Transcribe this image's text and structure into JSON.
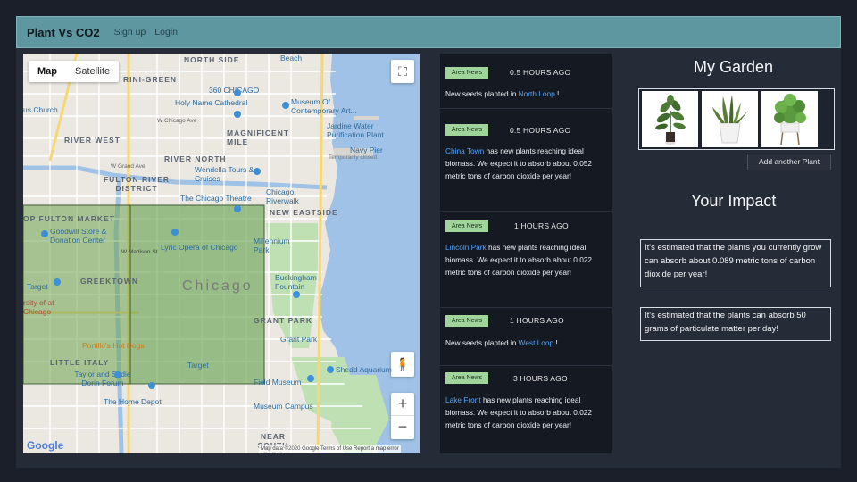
{
  "navbar": {
    "brand": "Plant Vs CO2",
    "links": [
      "Sign up",
      "Login"
    ]
  },
  "map": {
    "type_controls": [
      "Map",
      "Satellite"
    ],
    "active_type": "Map",
    "labels": {
      "north_side": "NORTH SIDE",
      "beach": "Beach",
      "old_town": "RINI-GREEN",
      "chicago360": "360 CHICAGO",
      "holy_name": "Holy Name Cathedral",
      "mca": "Museum Of Contemporary Art...",
      "church": "us Church",
      "chicago_ave": "W Chicago Ave",
      "river_west": "RIVER WEST",
      "magnificent": "MAGNIFICENT MILE",
      "jardine": "Jardine Water Purification Plant",
      "navy_pier": "Navy Pier",
      "navy_closed": "Temporarily closed",
      "river_north": "RIVER NORTH",
      "grand_ave": "W Grand Ave",
      "wendella": "Wendella Tours & Cruises",
      "fulton_river": "FULTON RIVER DISTRICT",
      "theatre": "The Chicago Theatre",
      "riverwalk": "Chicago Riverwalk",
      "fulton_market": "OP FULTON MARKET",
      "new_eastside": "NEW EASTSIDE",
      "goodwill": "Goodwill Store & Donation Center",
      "lyric": "Lyric Opera of Chicago",
      "millennium": "Millennium Park",
      "madison": "W Madison St",
      "greektown": "GREEKTOWN",
      "chicago": "Chicago",
      "target": "Target",
      "buckingham": "Buckingham Fountain",
      "university": "rsity of at Chicago",
      "grant_park": "GRANT PARK",
      "grant_park2": "Grant Park",
      "portillos": "Portillo's Hot Dogs",
      "little_italy": "LITTLE ITALY",
      "target2": "Target",
      "taylor": "Taylor and Sadie Dorin Forum",
      "shedd": "Shedd Aquarium",
      "field": "Field Museum",
      "home_depot": "The Home Depot",
      "museum_campus": "Museum Campus",
      "south_side": "NEAR SOUTH SIDE"
    },
    "google": "Google",
    "attribution": "Map data ©2020 Google   Terms of Use   Report a map error",
    "fullscreen_icon": "⛶",
    "pegman_icon": "🧍",
    "zoom_in": "+",
    "zoom_out": "−"
  },
  "news": [
    {
      "badge": "Area News",
      "time": "0.5 HOURS AGO",
      "pre": "New seeds planted in ",
      "loc": "North Loop",
      "post": " !"
    },
    {
      "badge": "Area News",
      "time": "0.5 HOURS AGO",
      "pre": "",
      "loc": "China Town",
      "post": " has new plants reaching ideal biomass. We expect it to absorb about 0.052 metric tons of carbon dioxide per year!"
    },
    {
      "badge": "Area News",
      "time": "1 HOURS AGO",
      "pre": "",
      "loc": "Lincoln Park",
      "post": " has new plants reaching ideal biomass. We expect it to absorb about 0.022 metric tons of carbon dioxide per year!"
    },
    {
      "badge": "Area News",
      "time": "1 HOURS AGO",
      "pre": "New seeds planted in ",
      "loc": "West Loop",
      "post": " !"
    },
    {
      "badge": "Area News",
      "time": "3 HOURS AGO",
      "pre": "",
      "loc": "Lake Front",
      "post": " has new plants reaching ideal biomass. We expect it to absorb about 0.022 metric tons of carbon dioxide per year!"
    }
  ],
  "garden": {
    "title": "My Garden",
    "plants": [
      "fiddle-leaf-fig-plant",
      "snake-plant",
      "pothos-plant"
    ],
    "add_button": "Add another Plant"
  },
  "impact": {
    "title": "Your Impact",
    "co2": "It's estimated that the plants you currently grow can absorb about 0.089 metric tons of carbon dioxide per year!",
    "pm": "It's estimated that the plants can absorb 50 grams of particulate matter per day!"
  }
}
